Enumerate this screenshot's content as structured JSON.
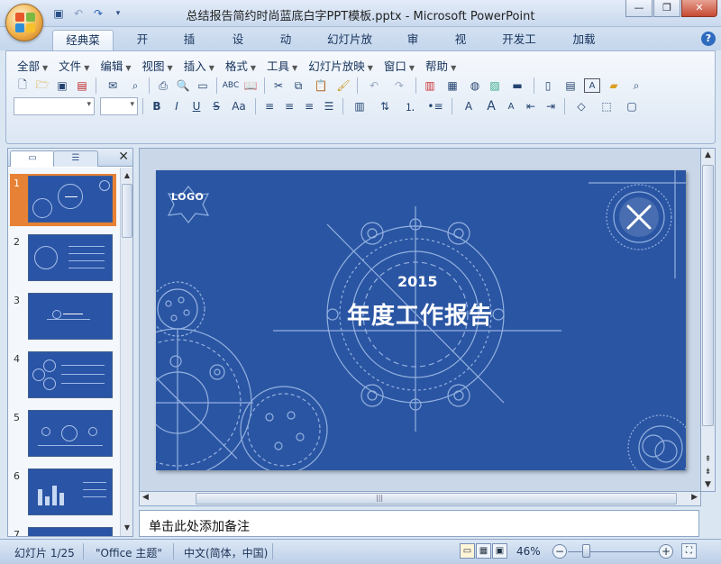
{
  "window": {
    "title": "总结报告简约时尚蓝底白字PPT模板.pptx - Microsoft PowerPoint",
    "controls": {
      "minimize": "—",
      "restore": "❐",
      "close": "✕"
    }
  },
  "quick_access": {
    "save": "💾",
    "undo": "↶",
    "redo": "↷",
    "more": "▾"
  },
  "tabs": [
    {
      "label": "经典菜单",
      "active": true
    },
    {
      "label": "开始"
    },
    {
      "label": "插入"
    },
    {
      "label": "设计"
    },
    {
      "label": "动画"
    },
    {
      "label": "幻灯片放映"
    },
    {
      "label": "审阅"
    },
    {
      "label": "视图"
    },
    {
      "label": "开发工具"
    },
    {
      "label": "加载项"
    }
  ],
  "help_label": "?",
  "menu": [
    "全部",
    "文件",
    "编辑",
    "视图",
    "插入",
    "格式",
    "工具",
    "幻灯片放映",
    "窗口",
    "帮助"
  ],
  "format_labels": {
    "bold": "B",
    "italic": "I",
    "underline": "U",
    "strike": "S",
    "case": "Aa",
    "font_color": "A",
    "grow": "A",
    "shrink": "A"
  },
  "panel": {
    "close": "✕"
  },
  "slides": [
    {
      "num": "1"
    },
    {
      "num": "2"
    },
    {
      "num": "3"
    },
    {
      "num": "4"
    },
    {
      "num": "5"
    },
    {
      "num": "6"
    },
    {
      "num": "7"
    }
  ],
  "slide": {
    "logo": "LOGO",
    "year": "2015",
    "title": "年度工作报告"
  },
  "notes_placeholder": "单击此处添加备注",
  "statusbar": {
    "slide_info": "幻灯片 1/25",
    "theme": "\"Office 主题\"",
    "language": "中文(简体，中国)",
    "zoom": "46%",
    "zoom_out": "−",
    "zoom_in": "+"
  }
}
